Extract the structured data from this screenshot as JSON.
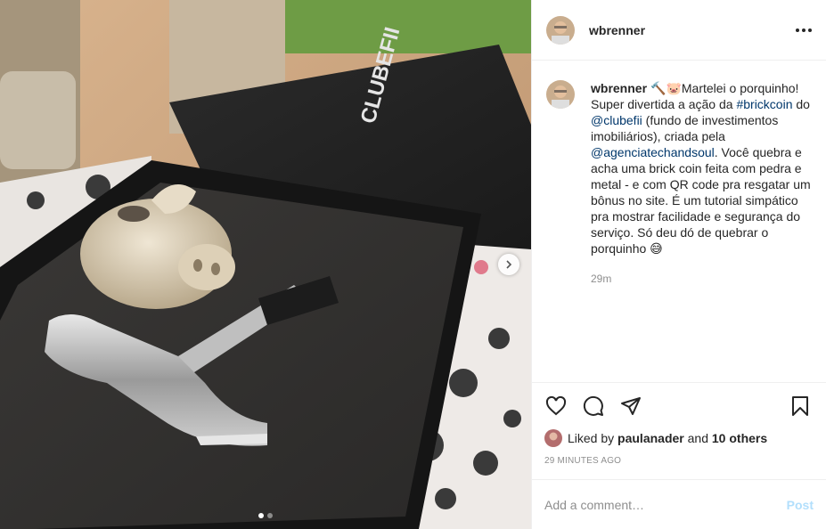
{
  "post": {
    "username": "wbrenner",
    "caption": {
      "username": "wbrenner",
      "segments": [
        {
          "text": "🔨🐷Martelei o porquinho! Super divertida a ação da ",
          "tag": false
        },
        {
          "text": "#brickcoin",
          "tag": true
        },
        {
          "text": " do ",
          "tag": false
        },
        {
          "text": "@clubefii",
          "tag": true
        },
        {
          "text": " (fundo de investimentos imobiliários), criada pela ",
          "tag": false
        },
        {
          "text": "@agenciatechandsoul",
          "tag": true
        },
        {
          "text": ". Você quebra e acha uma brick coin feita com pedra e metal - e com QR code pra resgatar um bônus no site. É um tutorial simpático pra mostrar facilidade e segurança do serviço. Só deu dó de quebrar o porquinho 😅",
          "tag": false
        }
      ],
      "time": "29m"
    },
    "likes": {
      "prefix": "Liked by",
      "user": "paulanader",
      "conjunction": "and",
      "others": "10 others"
    },
    "posted_ago": "29 MINUTES AGO",
    "comment_box": {
      "placeholder": "Add a comment…",
      "post_label": "Post"
    },
    "photo": {
      "box_brand": "CLUBEFII",
      "carousel": {
        "count": 2,
        "active": 0
      }
    },
    "icons": {
      "more": "more-options-icon",
      "like": "heart-icon",
      "comment": "comment-bubble-icon",
      "share": "paper-plane-icon",
      "save": "bookmark-icon",
      "next": "chevron-right-icon"
    },
    "colors": {
      "tag": "#00376b",
      "muted": "#8e8e8e",
      "post_button": "#b2dffc"
    }
  }
}
